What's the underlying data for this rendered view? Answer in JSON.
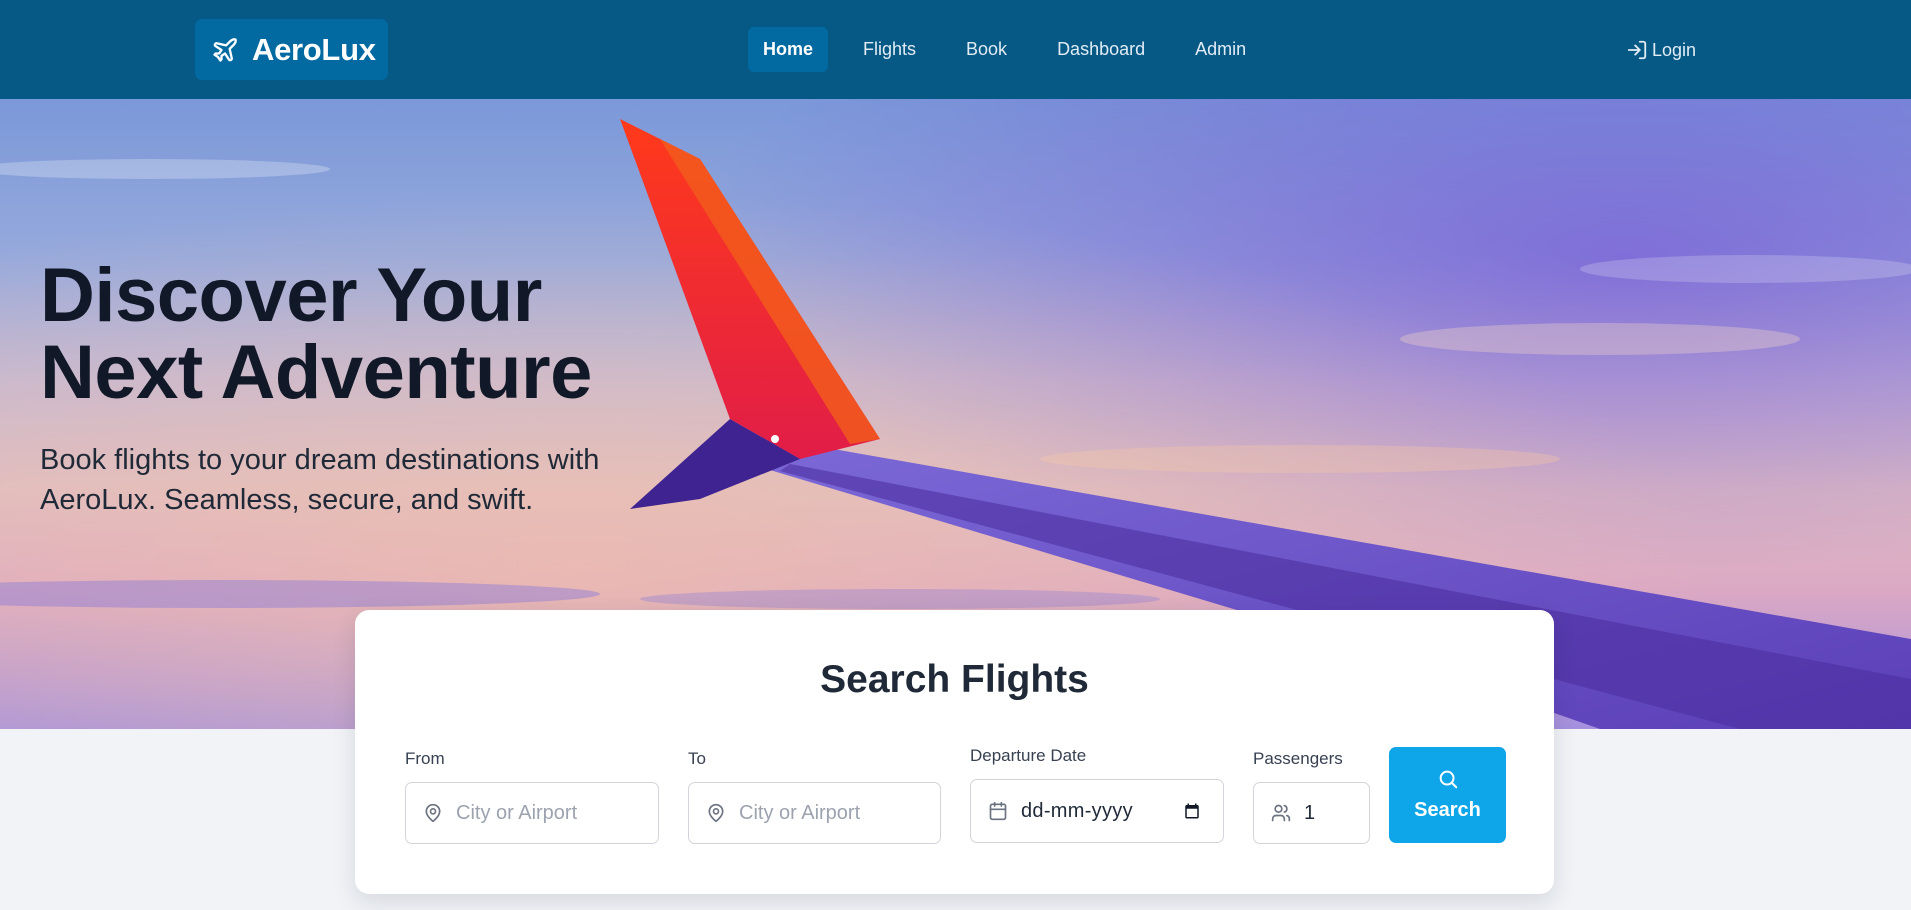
{
  "brand": {
    "name": "AeroLux",
    "icon": "plane-icon"
  },
  "nav": {
    "items": [
      {
        "label": "Home",
        "active": true
      },
      {
        "label": "Flights",
        "active": false
      },
      {
        "label": "Book",
        "active": false
      },
      {
        "label": "Dashboard",
        "active": false
      },
      {
        "label": "Admin",
        "active": false
      }
    ],
    "login": {
      "label": "Login",
      "icon": "login-icon"
    }
  },
  "hero": {
    "title_line1": "Discover Your",
    "title_line2": "Next Adventure",
    "subtitle_line1": "Book flights to your dream destinations with",
    "subtitle_line2": "AeroLux. Seamless, secure, and swift."
  },
  "search": {
    "title": "Search Flights",
    "from": {
      "label": "From",
      "placeholder": "City or Airport",
      "value": "",
      "icon": "map-pin-icon"
    },
    "to": {
      "label": "To",
      "placeholder": "City or Airport",
      "value": "",
      "icon": "map-pin-icon"
    },
    "date": {
      "label": "Departure Date",
      "value": "dd-mm-yyyy",
      "icon": "calendar-icon"
    },
    "passengers": {
      "label": "Passengers",
      "value": "1",
      "icon": "users-icon"
    },
    "button_label": "Search",
    "button_icon": "search-icon"
  },
  "colors": {
    "navbar": "#075985",
    "brand_bg": "#0369a1",
    "accent": "#0ea5e9",
    "heading": "#111827"
  }
}
